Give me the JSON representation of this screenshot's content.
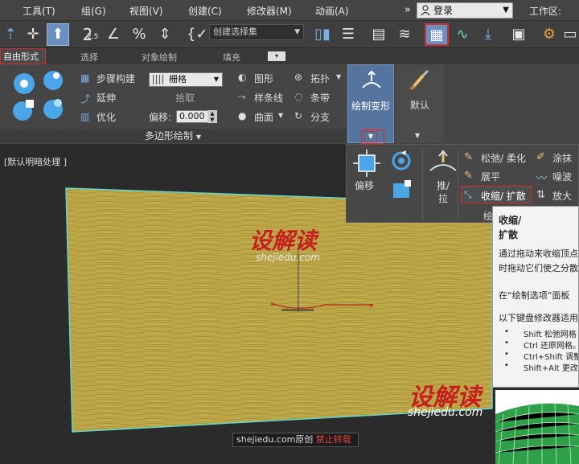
{
  "menubar": {
    "items": [
      "工具(T)",
      "组(G)",
      "视图(V)",
      "创建(C)",
      "修改器(M)",
      "动画(A)"
    ],
    "overflow": "»",
    "login": "登录",
    "workspace": "工作区:"
  },
  "toolbar": {
    "selection_set": "创建选择集",
    "snap_label": "2.5"
  },
  "ribbon_tabs": {
    "freeform": "自由形式",
    "selection": "选择",
    "object_paint": "对象绘制",
    "populate": "填充"
  },
  "ribbon": {
    "step_build": "步骤构建",
    "extend": "延伸",
    "optimize": "优化",
    "grid": "栅格",
    "pick": "拾取",
    "offset_label": "偏移:",
    "offset_value": "0.000",
    "shapes": "图形",
    "splines": "样条线",
    "surface": "曲面",
    "topology": "拓扑",
    "strips": "条带",
    "branches": "分支",
    "poly_draw": "多边形绘制",
    "paint_deform": "绘制变形",
    "default": "默认"
  },
  "dropdown": {
    "offset": "偏移",
    "push_pull_1": "推/",
    "push_pull_2": "拉",
    "relax_soften": "松弛/ 柔化",
    "flatten": "展平",
    "shrink_expand": "收缩/ 扩散",
    "smudge": "涂抹",
    "noise": "噪波",
    "amplify": "放大",
    "footer": "绘"
  },
  "tooltip": {
    "title_1": "收缩/",
    "title_2": "扩散",
    "line_1": "通过拖动来收缩顶点",
    "line_2": "时拖动它们使之分散",
    "line_3": "在“绘制选项”面板",
    "line_4": "以下键盘修改器适用",
    "bullet_1": "Shift 松弛网格",
    "bullet_2": "Ctrl 还原网格。",
    "bullet_3": "Ctrl+Shift 调整",
    "bullet_4": "Shift+Alt 更改"
  },
  "viewport": {
    "label": "[默认明暗处理 ]"
  },
  "watermark": {
    "logo": "设解读",
    "url": "shejiedu.com",
    "bar_text": "shejiedu.com原创",
    "bar_warning": "禁止转载"
  }
}
